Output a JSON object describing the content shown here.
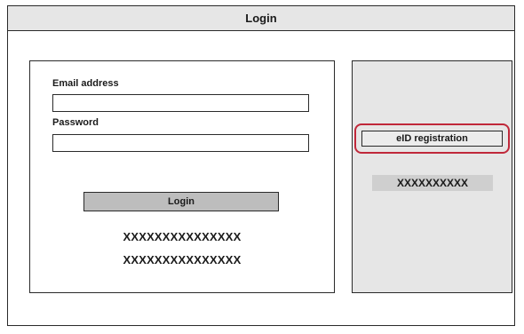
{
  "window": {
    "title": "Login"
  },
  "login_form": {
    "email_label": "Email address",
    "email_value": "",
    "password_label": "Password",
    "password_value": "",
    "login_button": "Login",
    "masked_line_1": "XXXXXXXXXXXXXXX",
    "masked_line_2": "XXXXXXXXXXXXXXX"
  },
  "eid_panel": {
    "registration_button": "eID registration",
    "masked_text": "XXXXXXXXXX",
    "highlight_color": "#c0283a"
  }
}
